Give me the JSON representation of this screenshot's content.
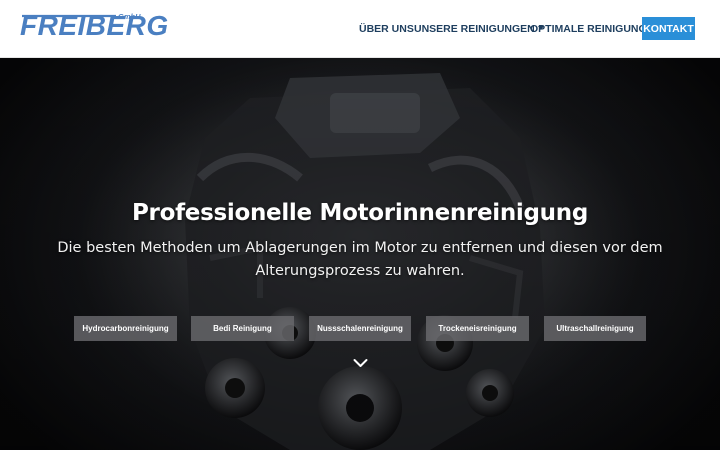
{
  "logo": {
    "text": "FREIBERG",
    "suffix": "GmbH"
  },
  "nav": {
    "items": [
      {
        "label": "ÜBER UNS"
      },
      {
        "label": "UNSERE REINIGUNGEN",
        "has_dropdown": true
      },
      {
        "label": "OPTIMALE REINIGUNG"
      }
    ],
    "cta": "KONTAKT"
  },
  "hero": {
    "title": "Professionelle Motorinnenreinigung",
    "subtitle": "Die besten Methoden um Ablagerungen im Motor zu entfernen und diesen vor dem Alterungsprozess zu wahren.",
    "buttons": [
      {
        "label": "Hydrocarbonreinigung"
      },
      {
        "label": "Bedi Reinigung"
      },
      {
        "label": "Nussschalenreinigung"
      },
      {
        "label": "Trockeneisreinigung"
      },
      {
        "label": "Ultraschallreinigung"
      }
    ],
    "scroll_icon": "chevron-down-icon"
  },
  "colors": {
    "brand_blue": "#4a7fc1",
    "nav_text": "#1e3e5e",
    "cta_bg": "#2a8fd8",
    "button_bg": "#69696c"
  }
}
